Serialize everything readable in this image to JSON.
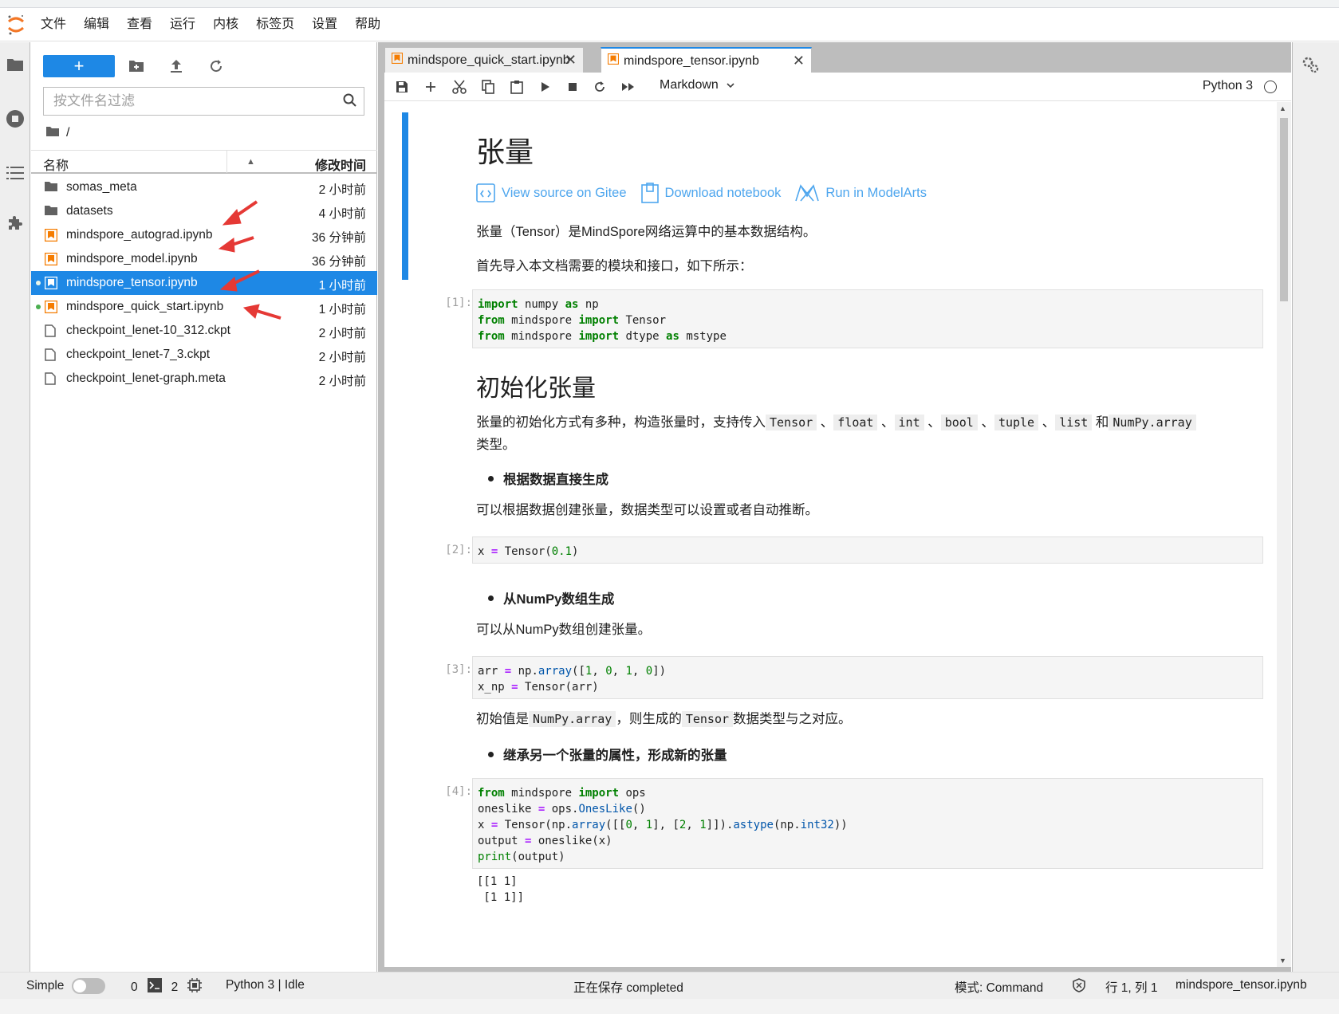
{
  "menubar": {
    "items": [
      "文件",
      "编辑",
      "查看",
      "运行",
      "内核",
      "标签页",
      "设置",
      "帮助"
    ]
  },
  "filebrowser": {
    "new_label": "+",
    "filter_placeholder": "按文件名过滤",
    "breadcrumb": "/",
    "col_name": "名称",
    "col_modified": "修改时间",
    "files": [
      {
        "name": "somas_meta",
        "type": "folder-icon",
        "modified": "2 小时前",
        "running": false,
        "selected": false
      },
      {
        "name": "datasets",
        "type": "folder-icon",
        "modified": "4 小时前",
        "running": false,
        "selected": false
      },
      {
        "name": "mindspore_autograd.ipynb",
        "type": "notebook-icon",
        "modified": "36 分钟前",
        "running": false,
        "selected": false
      },
      {
        "name": "mindspore_model.ipynb",
        "type": "notebook-icon",
        "modified": "36 分钟前",
        "running": false,
        "selected": false
      },
      {
        "name": "mindspore_tensor.ipynb",
        "type": "notebook-icon",
        "modified": "1 小时前",
        "running": true,
        "selected": true
      },
      {
        "name": "mindspore_quick_start.ipynb",
        "type": "notebook-icon",
        "modified": "1 小时前",
        "running": true,
        "selected": false
      },
      {
        "name": "checkpoint_lenet-10_312.ckpt",
        "type": "file-icon",
        "modified": "2 小时前",
        "running": false,
        "selected": false
      },
      {
        "name": "checkpoint_lenet-7_3.ckpt",
        "type": "file-icon",
        "modified": "2 小时前",
        "running": false,
        "selected": false
      },
      {
        "name": "checkpoint_lenet-graph.meta",
        "type": "file-icon",
        "modified": "2 小时前",
        "running": false,
        "selected": false
      }
    ]
  },
  "tabs": [
    {
      "label": "mindspore_quick_start.ipynb",
      "active": false
    },
    {
      "label": "mindspore_tensor.ipynb",
      "active": true
    }
  ],
  "toolbar": {
    "cell_type": "Markdown",
    "kernel": "Python 3"
  },
  "notebook": {
    "h1": "张量",
    "links": [
      "View source on Gitee",
      "Download notebook",
      "Run in ModelArts"
    ],
    "p1": "张量（Tensor）是MindSpore网络运算中的基本数据结构。",
    "p2": "首先导入本文档需要的模块和接口，如下所示：",
    "cell1_prompt": "[1]:",
    "h2": "初始化张量",
    "p3_a": "张量的初始化方式有多种，构造张量时，支持传入",
    "p3_codes": [
      "Tensor",
      "float",
      "int",
      "bool",
      "tuple",
      "list",
      "NumPy.array"
    ],
    "p3_sep": "、",
    "p3_and": "和",
    "p3_end": "类型。",
    "bullet1": "根据数据直接生成",
    "p4": "可以根据数据创建张量，数据类型可以设置或者自动推断。",
    "cell2_prompt": "[2]:",
    "bullet2": "从NumPy数组生成",
    "p5": "可以从NumPy数组创建张量。",
    "cell3_prompt": "[3]:",
    "p6_a": "初始值是",
    "p6_code1": "NumPy.array",
    "p6_b": "，则生成的",
    "p6_code2": "Tensor",
    "p6_c": "数据类型与之对应。",
    "bullet3": "继承另一个张量的属性，形成新的张量",
    "cell4_prompt": "[4]:",
    "output4_line1": "[[1 1]",
    "output4_line2": " [1 1]]"
  },
  "statusbar": {
    "simple": "Simple",
    "terminals": "0",
    "kernels": "2",
    "kernel_status": "Python 3 | Idle",
    "saving": "正在保存 completed",
    "mode": "模式:  Command",
    "position": "行 1, 列 1",
    "filename": "mindspore_tensor.ipynb"
  },
  "colors": {
    "accent": "#1e88e5",
    "notebook_icon": "#f57c00",
    "arrow": "#e53935",
    "running_dot": "#4caf50"
  }
}
